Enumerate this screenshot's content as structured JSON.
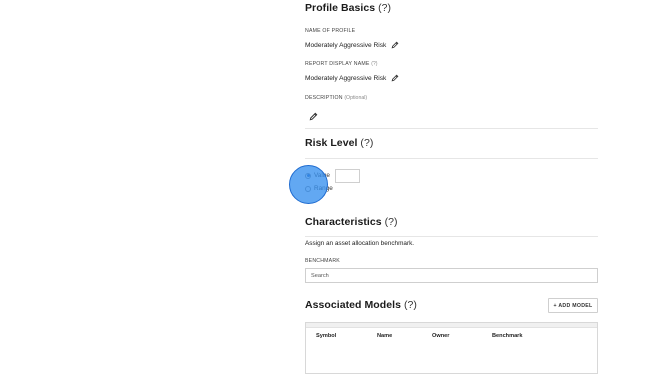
{
  "profile_basics": {
    "title": "Profile Basics",
    "help": "(?)",
    "name_label": "NAME OF PROFILE",
    "name_value": "Moderately Aggressive Risk",
    "display_label": "REPORT DISPLAY NAME",
    "display_help": "(?)",
    "display_value": "Moderately Aggressive Risk",
    "description_label": "DESCRIPTION",
    "description_optional": "(Optional)"
  },
  "risk_level": {
    "title": "Risk Level",
    "help": "(?)",
    "options": [
      "Value",
      "Range"
    ],
    "selected": "Value"
  },
  "characteristics": {
    "title": "Characteristics",
    "help": "(?)",
    "description": "Assign an asset allocation benchmark.",
    "benchmark_label": "BENCHMARK",
    "search_placeholder": "Search"
  },
  "associated_models": {
    "title": "Associated Models",
    "help": "(?)",
    "add_button": "+ ADD MODEL",
    "columns": [
      "Symbol",
      "Name",
      "Owner",
      "Benchmark"
    ]
  },
  "colors": {
    "highlight": "#368fee",
    "radio_selected": "#2b5fb3"
  },
  "icons": {
    "edit": "pencil-icon"
  }
}
